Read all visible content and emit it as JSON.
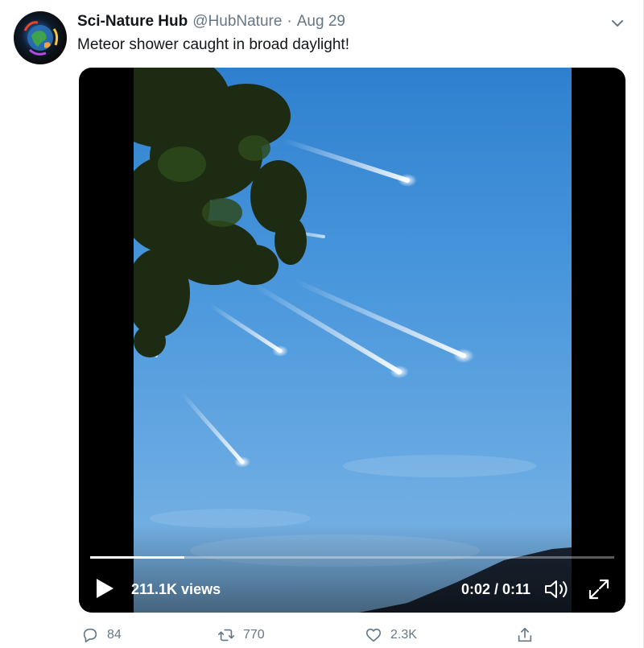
{
  "tweet": {
    "display_name": "Sci-Nature Hub",
    "handle": "@HubNature",
    "separator": "·",
    "date": "Aug 29",
    "text": "Meteor shower caught in broad daylight!",
    "menu_icon": "chevron-down-icon",
    "avatar_icon": "globe-logo-avatar"
  },
  "video": {
    "views": "211.1K views",
    "time": "0:02 / 0:11",
    "progress_fraction": 0.18,
    "play_icon": "play-icon",
    "volume_icon": "volume-icon",
    "fullscreen_icon": "fullscreen-icon"
  },
  "actions": {
    "reply": {
      "icon": "reply-icon",
      "count": "84"
    },
    "retweet": {
      "icon": "retweet-icon",
      "count": "770"
    },
    "like": {
      "icon": "heart-icon",
      "count": "2.3K"
    },
    "share": {
      "icon": "share-icon"
    }
  },
  "colors": {
    "text_primary": "#14171a",
    "text_secondary": "#657786",
    "sky": "#4a97dc"
  }
}
